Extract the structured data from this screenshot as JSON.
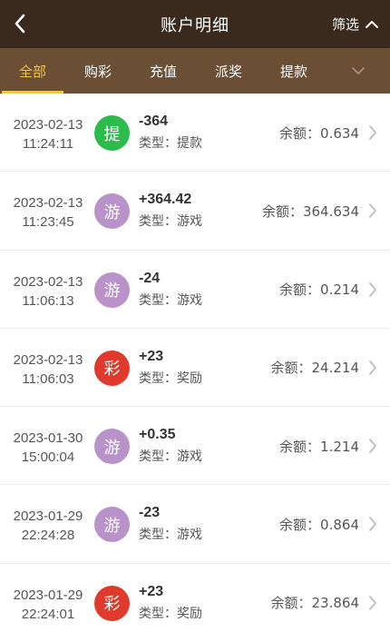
{
  "header": {
    "title": "账户明细",
    "filter_label": "筛选"
  },
  "tabs": [
    {
      "label": "全部",
      "active": true
    },
    {
      "label": "购彩",
      "active": false
    },
    {
      "label": "充值",
      "active": false
    },
    {
      "label": "派奖",
      "active": false
    },
    {
      "label": "提款",
      "active": false
    }
  ],
  "colors": {
    "header_bg": "#3a2a1e",
    "tab_bg": "#6b4f35",
    "accent": "#f0c64a",
    "badge_withdraw": "#2dbb4b",
    "badge_game": "#b892c9",
    "badge_prize": "#e03a2d"
  },
  "records": [
    {
      "date": "2023-02-13",
      "time": "11:24:11",
      "badge": "提",
      "badge_color": "#2dbb4b",
      "amount": "-364",
      "type": "类型：提款",
      "balance": "余额：0.634"
    },
    {
      "date": "2023-02-13",
      "time": "11:23:45",
      "badge": "游",
      "badge_color": "#b892c9",
      "amount": "+364.42",
      "type": "类型：游戏",
      "balance": "余额：364.634"
    },
    {
      "date": "2023-02-13",
      "time": "11:06:13",
      "badge": "游",
      "badge_color": "#b892c9",
      "amount": "-24",
      "type": "类型：游戏",
      "balance": "余额：0.214"
    },
    {
      "date": "2023-02-13",
      "time": "11:06:03",
      "badge": "彩",
      "badge_color": "#e03a2d",
      "amount": "+23",
      "type": "类型：奖励",
      "balance": "余额：24.214"
    },
    {
      "date": "2023-01-30",
      "time": "15:00:04",
      "badge": "游",
      "badge_color": "#b892c9",
      "amount": "+0.35",
      "type": "类型：游戏",
      "balance": "余额：1.214"
    },
    {
      "date": "2023-01-29",
      "time": "22:24:28",
      "badge": "游",
      "badge_color": "#b892c9",
      "amount": "-23",
      "type": "类型：游戏",
      "balance": "余额：0.864"
    },
    {
      "date": "2023-01-29",
      "time": "22:24:01",
      "badge": "彩",
      "badge_color": "#e03a2d",
      "amount": "+23",
      "type": "类型：奖励",
      "balance": "余额：23.864"
    }
  ]
}
